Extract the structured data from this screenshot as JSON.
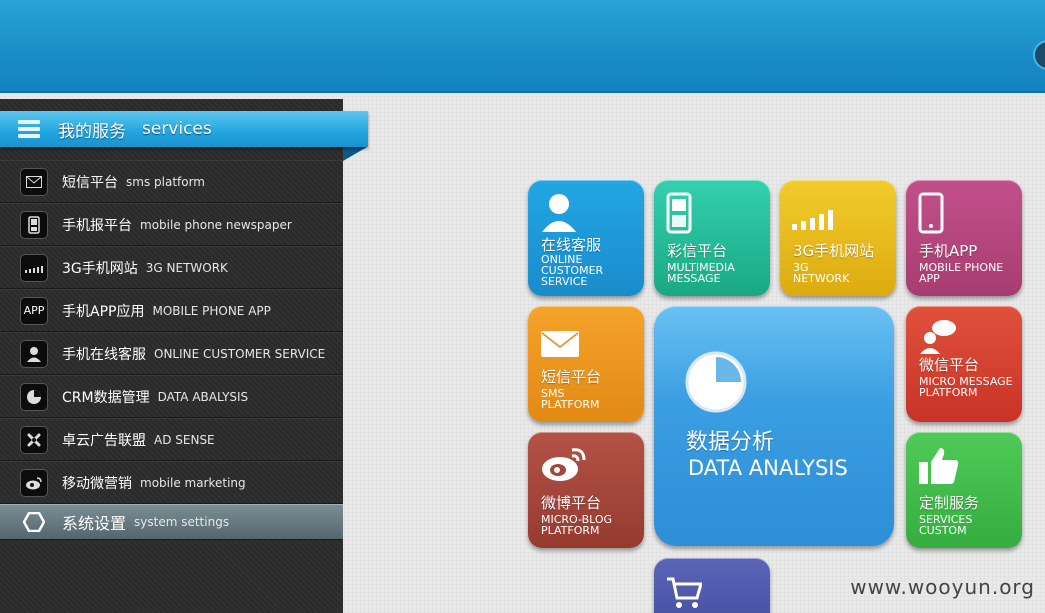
{
  "sidebar": {
    "header_cn": "我的服务",
    "header_en": "services",
    "items": [
      {
        "cn": "短信平台",
        "en": "sms platform",
        "icon": "envelope-icon"
      },
      {
        "cn": "手机报平台",
        "en": "mobile phone newspaper",
        "icon": "phone-icon"
      },
      {
        "cn": "3G手机网站",
        "en": "3G NETWORK",
        "icon": "signal-icon"
      },
      {
        "cn": "手机APP应用",
        "en": "MOBILE PHONE APP",
        "icon_text": "APP",
        "icon": "app-icon"
      },
      {
        "cn": "手机在线客服",
        "en": "ONLINE CUSTOMER SERVICE",
        "icon": "user-icon"
      },
      {
        "cn": "CRM数据管理",
        "en": "DATA ABALYSIS",
        "icon": "pie-chart-icon"
      },
      {
        "cn": "卓云广告联盟",
        "en": "AD SENSE",
        "icon": "joomla-icon"
      },
      {
        "cn": "移动微营销",
        "en": "mobile marketing",
        "icon": "weibo-icon"
      },
      {
        "cn": "系统设置",
        "en": "system settings",
        "icon": "hexagon-icon"
      }
    ]
  },
  "tiles": {
    "online": {
      "cn": "在线客服",
      "en": "ONLINE CUSTOMER SERVICE",
      "color": "#1e98d6"
    },
    "mms": {
      "cn": "彩信平台",
      "en": "MULTIMEDIA MESSAGE",
      "color": "#23b899"
    },
    "g3": {
      "cn": "3G手机网站",
      "en": "3G NETWORK",
      "color": "#e7bb16"
    },
    "app": {
      "cn": "手机APP",
      "en": "MOBILE PHONE APP",
      "color": "#b2457b"
    },
    "sms": {
      "cn": "短信平台",
      "en": "SMS PLATFORM",
      "color": "#ec9420"
    },
    "data": {
      "cn": "数据分析",
      "en": "DATA ANALYSIS",
      "color": "#3b9fe0"
    },
    "wechat": {
      "cn": "微信平台",
      "en": "MICRO MESSAGE PLATFORM",
      "color": "#d7402f"
    },
    "weibo": {
      "cn": "微博平台",
      "en": "MICRO-BLOG PLATFORM",
      "color": "#a2473c"
    },
    "custom": {
      "cn": "定制服务",
      "en": "SERVICES CUSTOM",
      "color": "#3fbc4b"
    },
    "cart": {
      "color": "#4f5aac"
    }
  },
  "watermark": "www.wooyun.org"
}
